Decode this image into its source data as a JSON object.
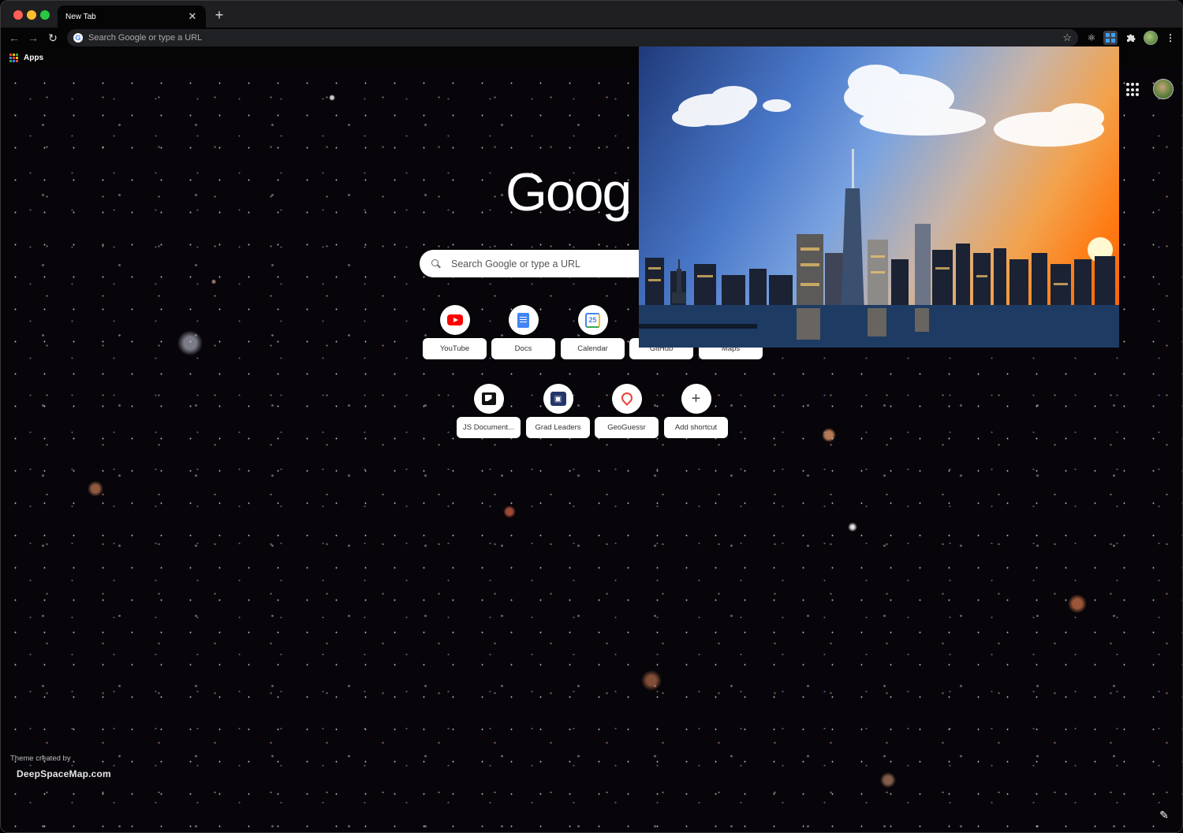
{
  "window": {
    "tab_title": "New Tab"
  },
  "toolbar": {
    "omnibox_placeholder": "Search Google or type a URL"
  },
  "bookmarks": {
    "apps_label": "Apps"
  },
  "ntp": {
    "logo_text": "Goog",
    "search_placeholder": "Search Google or type a URL",
    "shortcuts_row1": [
      {
        "label": "YouTube",
        "icon": "youtube-icon"
      },
      {
        "label": "Docs",
        "icon": "docs-icon"
      },
      {
        "label": "Calendar",
        "icon": "calendar-icon",
        "icon_text": "25"
      },
      {
        "label": "GitHub",
        "icon": "github-icon"
      },
      {
        "label": "Maps",
        "icon": "maps-icon"
      }
    ],
    "shortcuts_row2": [
      {
        "label": "JS Document...",
        "icon": "js-documentation-icon"
      },
      {
        "label": "Grad Leaders",
        "icon": "grad-leaders-icon"
      },
      {
        "label": "GeoGuessr",
        "icon": "location-pin-icon"
      },
      {
        "label": "Add shortcut",
        "icon": "plus-icon",
        "icon_text": "+"
      }
    ],
    "theme_credit_line1": "Theme created by",
    "theme_credit_line2": "DeepSpaceMap.com"
  },
  "colors": {
    "accent_blue": "#4285f4",
    "close_red": "#ff5f57",
    "minimize_yellow": "#febc2e",
    "maximize_green": "#28c840"
  }
}
